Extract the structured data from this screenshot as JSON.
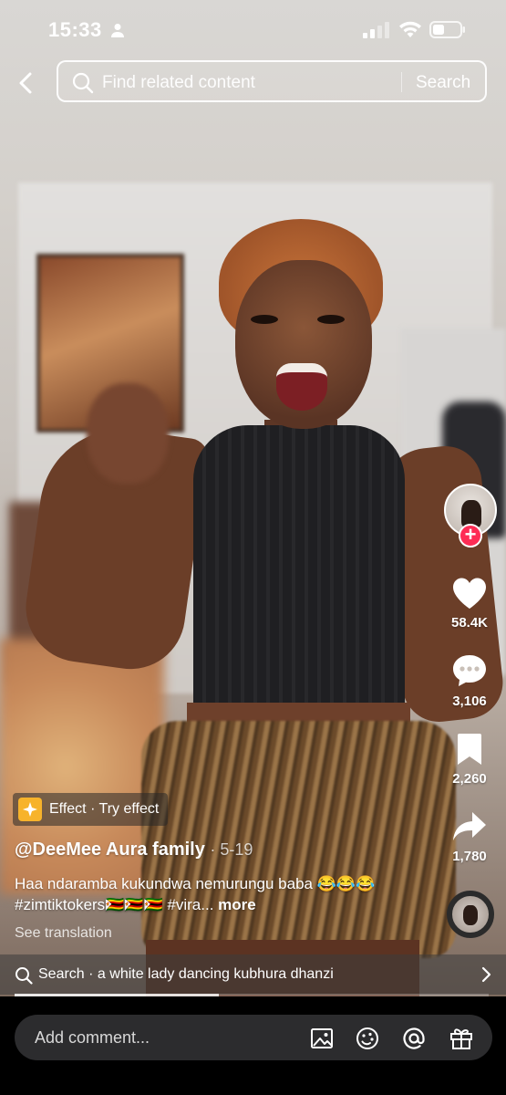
{
  "status": {
    "time": "15:33"
  },
  "search": {
    "placeholder": "Find related content",
    "button": "Search"
  },
  "actions": {
    "likes": "58.4K",
    "comments": "3,106",
    "saves": "2,260",
    "shares": "1,780"
  },
  "effect": {
    "label": "Effect · Try effect"
  },
  "post": {
    "author": "@DeeMee Aura family",
    "date": "· 5-19",
    "caption": "Haa ndaramba kukundwa nemurungu baba 😂😂😂#zimtiktokers🇿🇼🇿🇼🇿🇼 #vira...",
    "more": "more",
    "translate": "See translation"
  },
  "suggestion": {
    "text": "Search · a white lady dancing kubhura dhanzi"
  },
  "progress": {
    "fraction": 0.43
  },
  "comment": {
    "placeholder": "Add comment..."
  },
  "colors": {
    "follow": "#fe2c55",
    "effect": "#f7b32b"
  }
}
